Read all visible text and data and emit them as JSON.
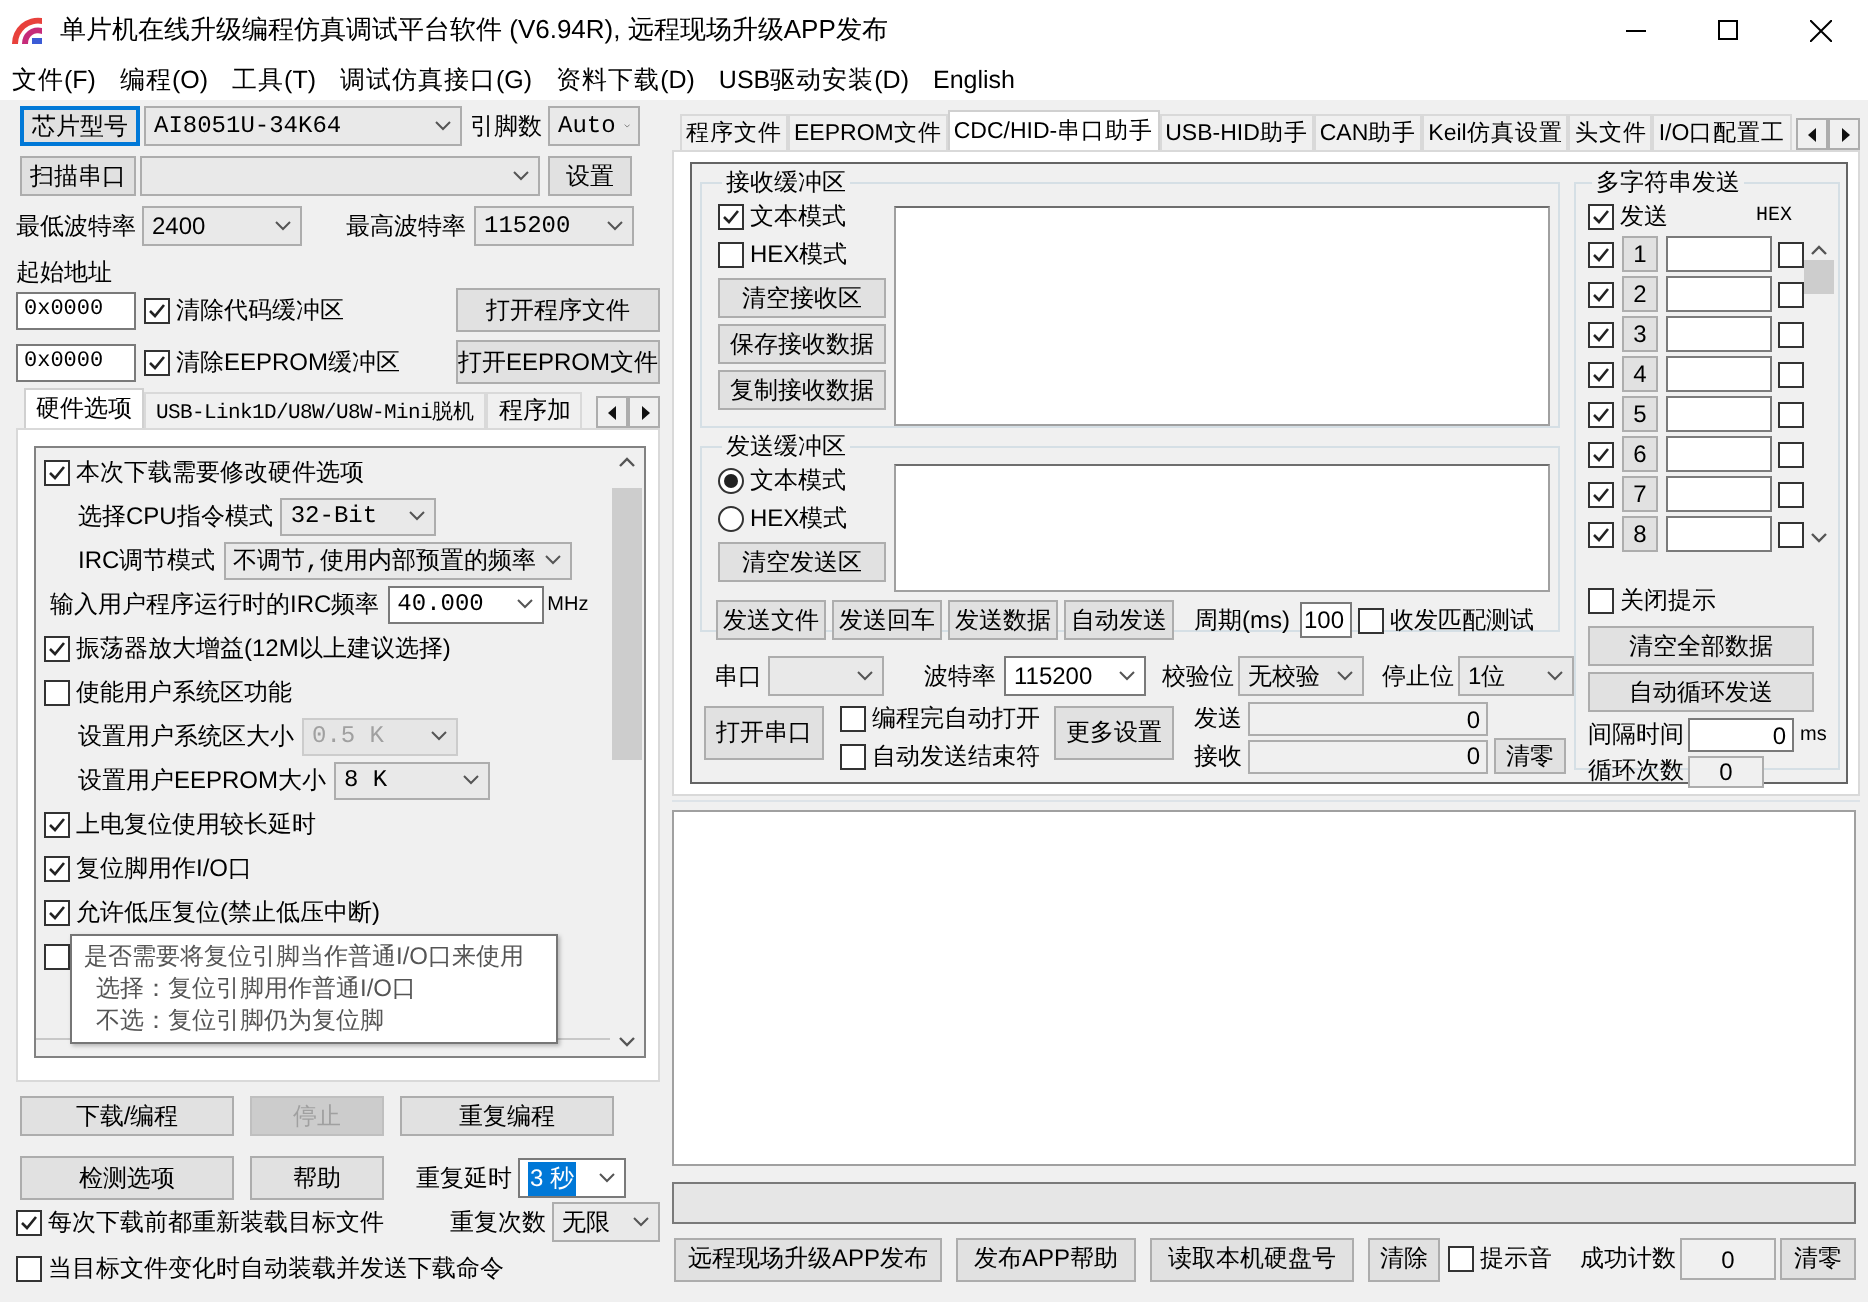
{
  "window": {
    "title": "单片机在线升级编程仿真调试平台软件 (V6.94R), 远程现场升级APP发布"
  },
  "menu": [
    "文件(F)",
    "编程(O)",
    "工具(T)",
    "调试仿真接口(G)",
    "资料下载(D)",
    "USB驱动安装(D)",
    "English"
  ],
  "chip": {
    "button": "芯片型号",
    "model": "AI8051U-34K64",
    "pins_label": "引脚数",
    "pins": "Auto"
  },
  "port": {
    "button": "扫描串口",
    "settings_button": "设置"
  },
  "baud": {
    "min_label": "最低波特率",
    "min": "2400",
    "max_label": "最高波特率",
    "max": "115200"
  },
  "start_address": {
    "label": "起始地址",
    "code": "0x0000",
    "eeprom": "0x0000"
  },
  "clear_code": {
    "label": "清除代码缓冲区",
    "checked": true
  },
  "clear_eeprom": {
    "label": "清除EEPROM缓冲区",
    "checked": true
  },
  "open_program_button": "打开程序文件",
  "open_eeprom_button": "打开EEPROM文件",
  "left_tabs": [
    {
      "label": "硬件选项",
      "selected": true
    },
    {
      "label": "USB-Link1D/U8W/U8W-Mini脱机",
      "selected": false
    },
    {
      "label": "程序加",
      "selected": false
    }
  ],
  "hardware_options": [
    {
      "kind": "check",
      "label": "本次下载需要修改硬件选项",
      "checked": true,
      "children": [
        {
          "kind": "combo",
          "label": "选择CPU指令模式",
          "value": "32-Bit",
          "disabled": false
        },
        {
          "kind": "combo",
          "label": "IRC调节模式",
          "value": "不调节,使用内部预置的频率",
          "disabled": false
        }
      ]
    },
    {
      "kind": "combo",
      "label": "输入用户程序运行时的IRC频率",
      "value": "40.000",
      "unit": "MHz",
      "disabled": false
    },
    {
      "kind": "check",
      "label": "振荡器放大增益(12M以上建议选择)",
      "checked": true
    },
    {
      "kind": "check",
      "label": "使能用户系统区功能",
      "checked": false,
      "children": [
        {
          "kind": "combo",
          "label": "设置用户系统区大小",
          "value": "0.5 K",
          "disabled": true
        },
        {
          "kind": "combo",
          "label": "设置用户EEPROM大小",
          "value": "8   K",
          "disabled": false
        }
      ]
    },
    {
      "kind": "check",
      "label": "上电复位使用较长延时",
      "checked": true
    },
    {
      "kind": "check",
      "label": "复位脚用作I/O口",
      "checked": true
    },
    {
      "kind": "check",
      "label": "允许低压复位(禁止低压中断)",
      "checked": true
    },
    {
      "kind": "check",
      "checked": false
    }
  ],
  "tooltip": [
    "是否需要将复位引脚当作普通I/O口来使用",
    "选择：复位引脚用作普通I/O口",
    "不选：复位引脚仍为复位脚"
  ],
  "download": {
    "buttons": [
      {
        "label": "下载/编程",
        "disabled": false
      },
      {
        "label": "停止",
        "disabled": true
      },
      {
        "label": "重复编程",
        "disabled": false
      },
      {
        "label": "检测选项",
        "disabled": false
      },
      {
        "label": "帮助",
        "disabled": false
      }
    ],
    "repeat_delay_label": "重复延时",
    "repeat_delay": "3 秒",
    "repeat_count_label": "重复次数",
    "repeat_count": "无限",
    "reload": {
      "label": "每次下载前都重新装载目标文件",
      "checked": true
    },
    "auto_send": {
      "label": "当目标文件变化时自动装载并发送下载命令",
      "checked": false
    }
  },
  "right_tabs": [
    {
      "label": "程序文件",
      "selected": false
    },
    {
      "label": "EEPROM文件",
      "selected": false
    },
    {
      "label": "CDC/HID-串口助手",
      "selected": true
    },
    {
      "label": "USB-HID助手",
      "selected": false
    },
    {
      "label": "CAN助手",
      "selected": false
    },
    {
      "label": "Keil仿真设置",
      "selected": false
    },
    {
      "label": "头文件",
      "selected": false
    },
    {
      "label": "I/O口配置工",
      "selected": false
    }
  ],
  "receive": {
    "title": "接收缓冲区",
    "modes": [
      {
        "label": "文本模式",
        "checked": true
      },
      {
        "label": "HEX模式",
        "checked": false
      }
    ],
    "buttons": [
      "清空接收区",
      "保存接收数据",
      "复制接收数据"
    ]
  },
  "send": {
    "title": "发送缓冲区",
    "modes": [
      {
        "label": "文本模式",
        "selected": true
      },
      {
        "label": "HEX模式",
        "selected": false
      }
    ],
    "clear_button": "清空发送区",
    "buttons": [
      "发送文件",
      "发送回车",
      "发送数据",
      "自动发送"
    ],
    "period_label": "周期(ms)",
    "period": "100",
    "match_test": {
      "label": "收发匹配测试",
      "checked": false
    }
  },
  "serial": {
    "port_label": "串口",
    "baud_label": "波特率",
    "baud": "115200",
    "parity_label": "校验位",
    "parity": "无校验",
    "stop_label": "停止位",
    "stop": "1位",
    "open_button": "打开串口",
    "auto_open": {
      "label": "编程完自动打开",
      "checked": false
    },
    "auto_end": {
      "label": "自动发送结束符",
      "checked": false
    },
    "more_button": "更多设置",
    "sent_label": "发送",
    "sent": "0",
    "received_label": "接收",
    "received": "0",
    "clear_button": "清零"
  },
  "multi_send": {
    "title": "多字符串发送",
    "send_all": {
      "label": "发送",
      "checked": true
    },
    "hex_label": "HEX",
    "rows": [
      {
        "number": "1",
        "checked": true,
        "hex": false
      },
      {
        "number": "2",
        "checked": true,
        "hex": false
      },
      {
        "number": "3",
        "checked": true,
        "hex": false
      },
      {
        "number": "4",
        "checked": true,
        "hex": false
      },
      {
        "number": "5",
        "checked": true,
        "hex": false
      },
      {
        "number": "6",
        "checked": true,
        "hex": false
      },
      {
        "number": "7",
        "checked": true,
        "hex": false
      },
      {
        "number": "8",
        "checked": true,
        "hex": false
      }
    ],
    "close_tip": {
      "label": "关闭提示",
      "checked": false
    },
    "clear_all_button": "清空全部数据",
    "loop_button": "自动循环发送",
    "interval_label": "间隔时间",
    "interval": "0",
    "interval_unit": "ms",
    "loop_count_label": "循环次数",
    "loop_count": "0"
  },
  "progress": {
    "level": 0
  },
  "bottom": {
    "buttons": [
      "远程现场升级APP发布",
      "发布APP帮助",
      "读取本机硬盘号",
      "清除"
    ],
    "beep": {
      "label": "提示音",
      "checked": false
    },
    "success_label": "成功计数",
    "success_count": "0",
    "clear_button": "清零"
  }
}
